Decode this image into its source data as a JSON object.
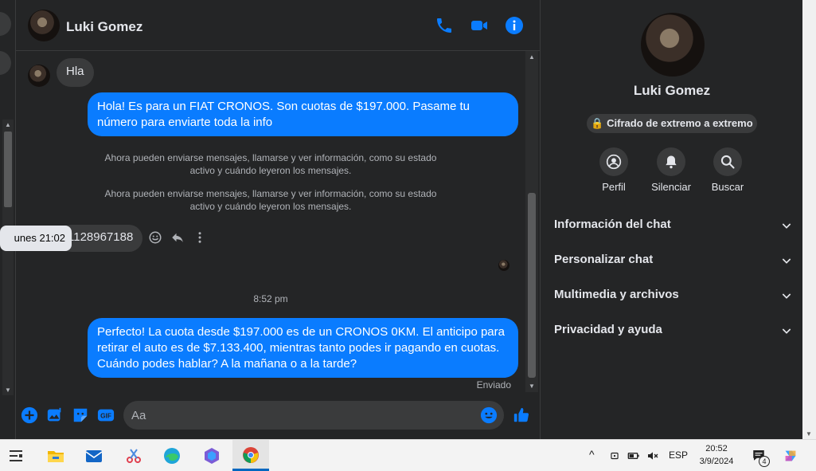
{
  "contact": {
    "name": "Luki Gomez"
  },
  "messages": {
    "incoming_1": "Hla",
    "outgoing_1": "Hola! Es para un FIAT CRONOS. Son cuotas de $197.000. Pasame tu número para enviarte toda la info",
    "system_1": "Ahora pueden enviarse mensajes, llamarse y ver información, como su estado activo y cuándo leyeron los mensajes.",
    "system_2": "Ahora pueden enviarse mensajes, llamarse y ver información, como su estado activo y cuándo leyeron los mensajes.",
    "tooltip": "unes 21:02",
    "incoming_2": "1128967188",
    "time_separator": "8:52 pm",
    "outgoing_2": "Perfecto! La cuota desde $197.000 es de un CRONOS 0KM. El anticipo para retirar el auto es de $7.133.400, mientras tanto podes ir pagando en cuotas. Cuándo podes hablar? A la mañana o a la tarde?",
    "status": "Enviado"
  },
  "composer": {
    "placeholder": "Aa"
  },
  "info_panel": {
    "name": "Luki Gomez",
    "encryption": "Cifrado de extremo a extremo",
    "actions": [
      {
        "label": "Perfil",
        "icon": "profile-icon"
      },
      {
        "label": "Silenciar",
        "icon": "bell-icon"
      },
      {
        "label": "Buscar",
        "icon": "search-icon"
      }
    ],
    "sections": [
      "Información del chat",
      "Personalizar chat",
      "Multimedia y archivos",
      "Privacidad y ayuda"
    ]
  },
  "taskbar": {
    "language": "ESP",
    "time": "20:52",
    "date": "3/9/2024",
    "notifications": "4"
  },
  "colors": {
    "accent": "#0a7cff",
    "background": "#242526",
    "bubble_in": "#3a3b3c"
  }
}
